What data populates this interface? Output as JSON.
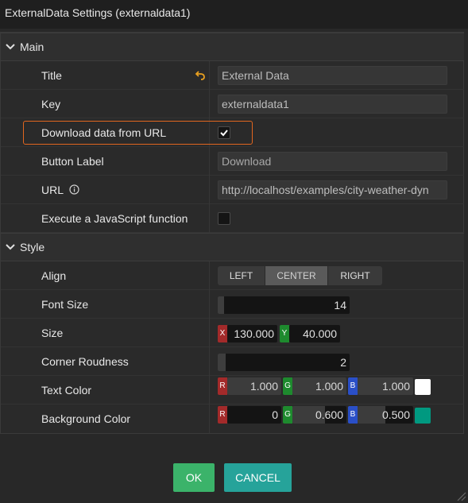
{
  "window": {
    "title": "ExternalData Settings (externaldata1)"
  },
  "sections": {
    "main": "Main",
    "style": "Style"
  },
  "main": {
    "title": {
      "label": "Title",
      "value": "External Data"
    },
    "key": {
      "label": "Key",
      "value": "externaldata1"
    },
    "download": {
      "label": "Download data from URL",
      "checked": true
    },
    "button_label": {
      "label": "Button Label",
      "placeholder": "Download"
    },
    "url": {
      "label": "URL",
      "value": "http://localhost/examples/city-weather-dyn"
    },
    "exec_js": {
      "label": "Execute a JavaScript function",
      "checked": false
    }
  },
  "style": {
    "align": {
      "label": "Align",
      "options": [
        "LEFT",
        "CENTER",
        "RIGHT"
      ],
      "selected": "CENTER"
    },
    "font_size": {
      "label": "Font Size",
      "value": "14"
    },
    "size": {
      "label": "Size",
      "x_tag": "X",
      "y_tag": "Y",
      "x": "130.000",
      "y": "40.000"
    },
    "corner": {
      "label": "Corner Roudness",
      "value": "2"
    },
    "text_color": {
      "label": "Text Color",
      "r_tag": "R",
      "g_tag": "G",
      "b_tag": "B",
      "r": "1.000",
      "g": "1.000",
      "b": "1.000",
      "swatch": "#ffffff"
    },
    "bg_color": {
      "label": "Background Color",
      "r_tag": "R",
      "g_tag": "G",
      "b_tag": "B",
      "r": "0",
      "g": "0.600",
      "b": "0.500",
      "swatch": "#009980"
    }
  },
  "buttons": {
    "ok": "OK",
    "cancel": "CANCEL"
  },
  "colors": {
    "ok": "#3bb36a",
    "cancel": "#26a39a",
    "highlight": "#e2661f",
    "revert": "#e8a020",
    "check": "#ffffff"
  }
}
